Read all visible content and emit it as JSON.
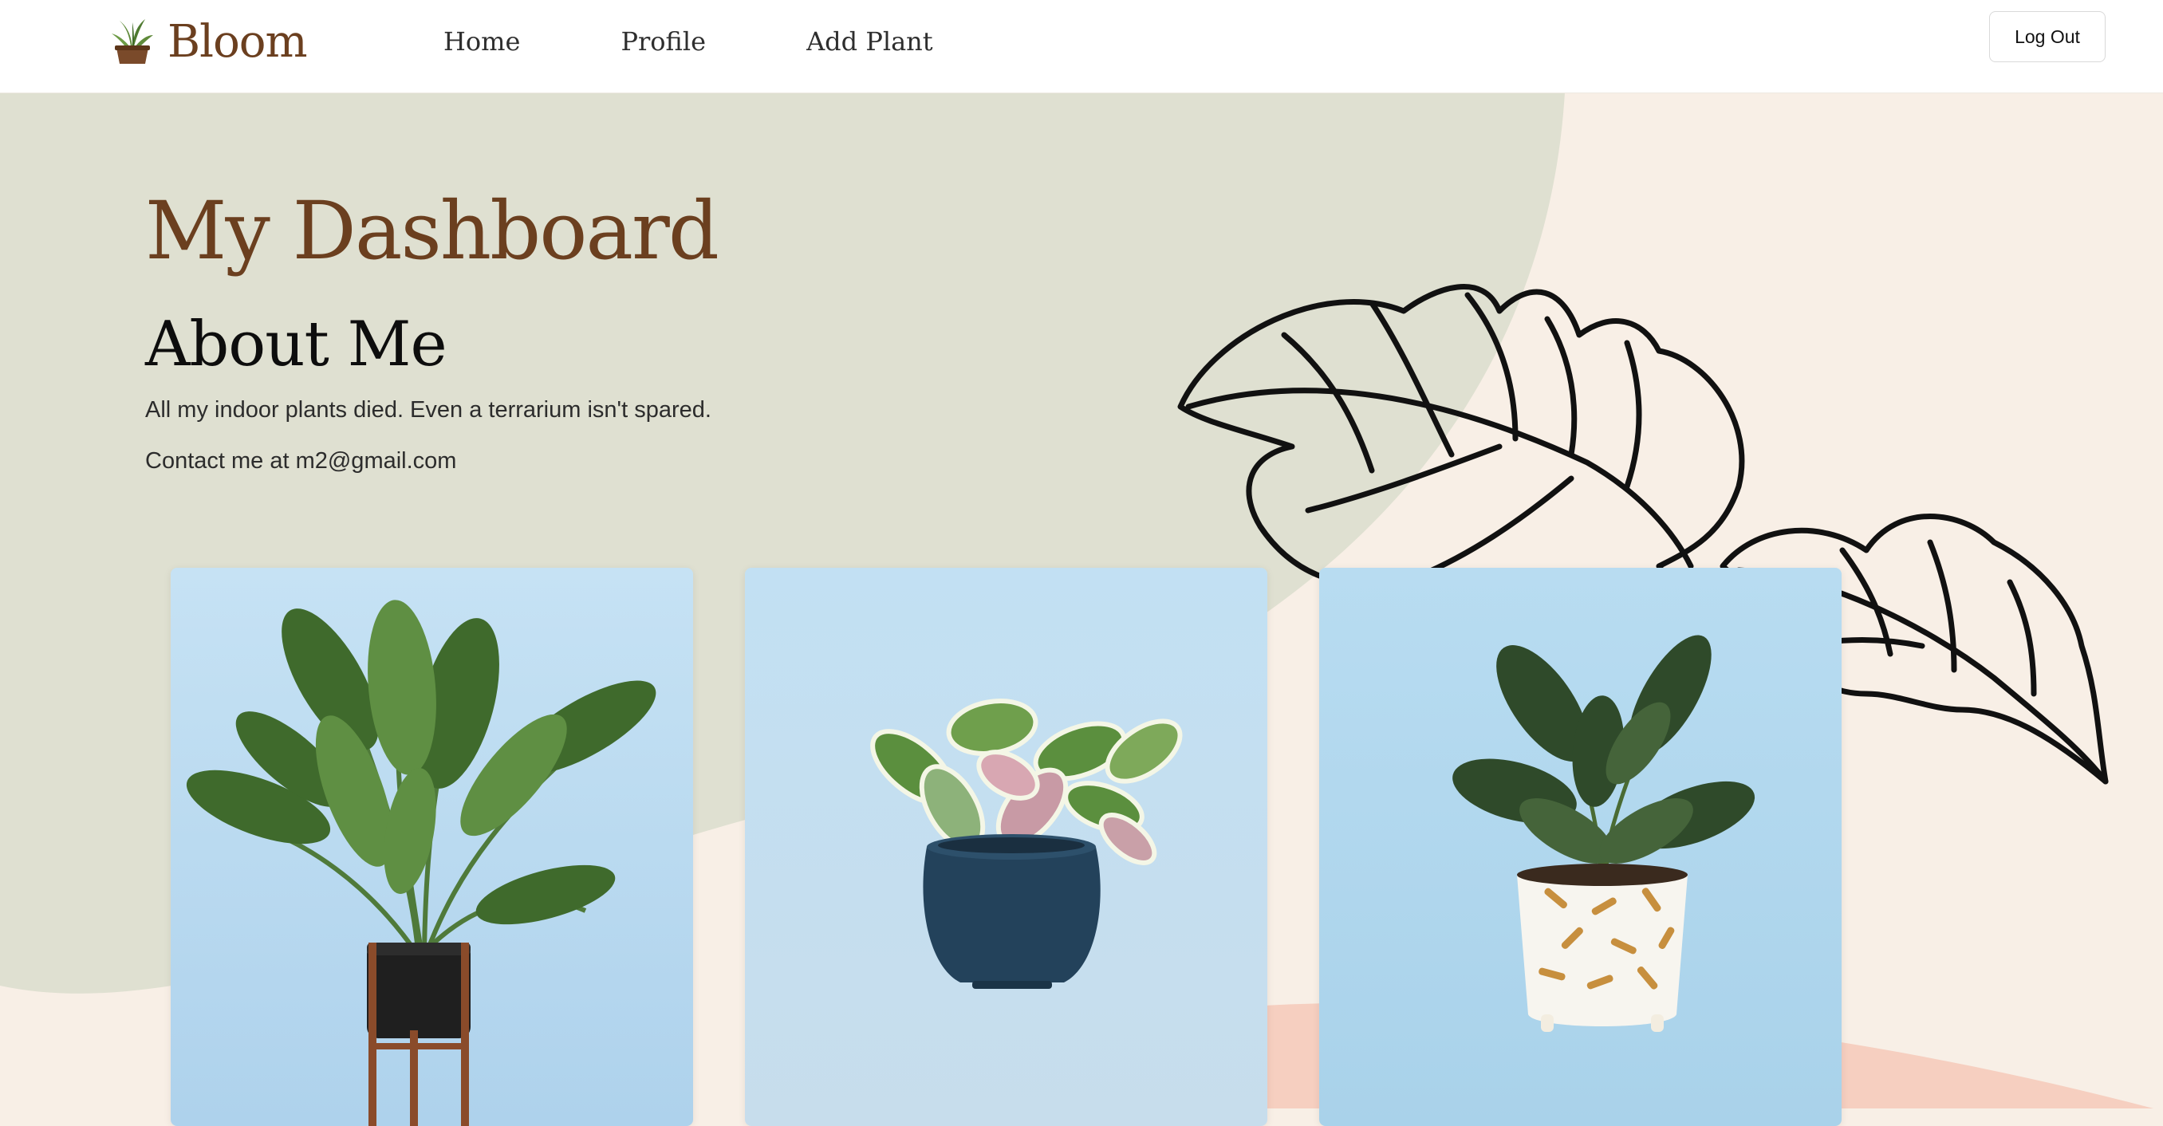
{
  "nav": {
    "brand": "Bloom",
    "links": [
      {
        "label": "Home"
      },
      {
        "label": "Profile"
      },
      {
        "label": "Add Plant"
      }
    ],
    "logout_label": "Log Out"
  },
  "dashboard": {
    "title": "My Dashboard",
    "about_heading": "About Me",
    "bio": "All my indoor plants died. Even a terrarium isn't spared.",
    "contact": "Contact me at m2@gmail.com"
  },
  "plants": [
    {
      "icon": "peace-lily-plant-image"
    },
    {
      "icon": "hoya-plant-image"
    },
    {
      "icon": "ficus-plant-image"
    }
  ],
  "colors": {
    "brand_brown": "#6b3f1f",
    "sage_background": "#dfe0d1",
    "cream_background": "#f8efe6",
    "peach_accent": "#f6cfc0",
    "card_sky": "#bcdcf0"
  }
}
